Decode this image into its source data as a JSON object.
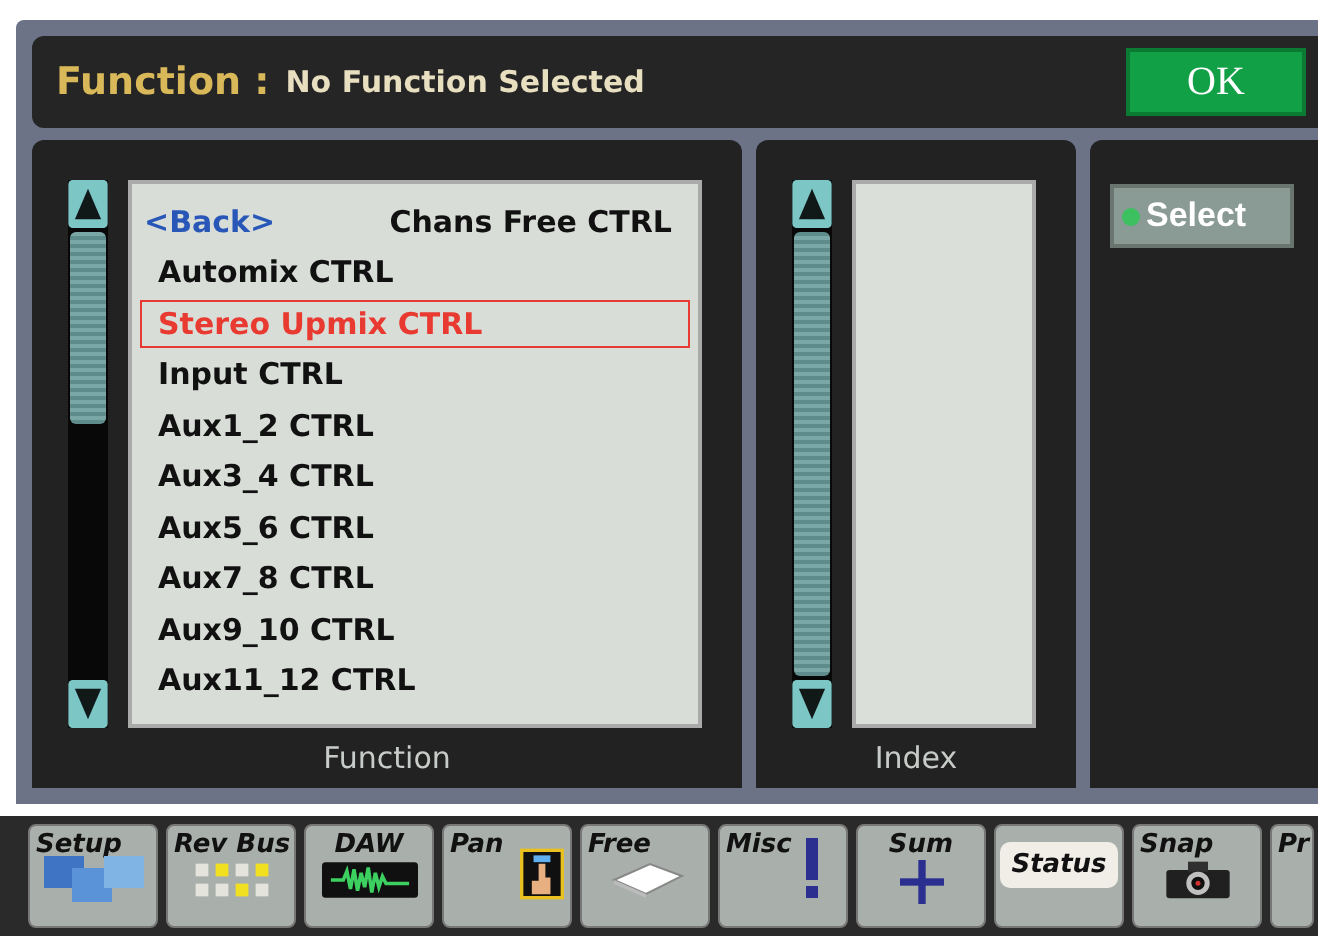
{
  "header": {
    "title": "Function :",
    "status": "No Function Selected",
    "ok_button": "OK"
  },
  "function_panel": {
    "back_link": "<Back>",
    "items": [
      {
        "label": "Chans Free CTRL",
        "selected": false
      },
      {
        "label": "Automix CTRL",
        "selected": false
      },
      {
        "label": "Stereo Upmix CTRL",
        "selected": true
      },
      {
        "label": "Input CTRL",
        "selected": false
      },
      {
        "label": "Aux1_2 CTRL",
        "selected": false
      },
      {
        "label": "Aux3_4 CTRL",
        "selected": false
      },
      {
        "label": "Aux5_6 CTRL",
        "selected": false
      },
      {
        "label": "Aux7_8 CTRL",
        "selected": false
      },
      {
        "label": "Aux9_10 CTRL",
        "selected": false
      },
      {
        "label": "Aux11_12 CTRL",
        "selected": false
      }
    ],
    "caption": "Function"
  },
  "index_panel": {
    "caption": "Index"
  },
  "select_button": "Select",
  "tabs": [
    {
      "label": "Setup",
      "kind": "setup",
      "selected": false
    },
    {
      "label": "Rev Bus",
      "kind": "revbus",
      "selected": false
    },
    {
      "label": "DAW",
      "kind": "daw",
      "selected": false
    },
    {
      "label": "Pan",
      "kind": "pan",
      "selected": false
    },
    {
      "label": "Free",
      "kind": "free",
      "selected": false
    },
    {
      "label": "Misc",
      "kind": "misc",
      "selected": false
    },
    {
      "label": "Sum",
      "kind": "sum",
      "selected": false
    },
    {
      "label": "Status",
      "kind": "status",
      "selected": true
    },
    {
      "label": "Snap",
      "kind": "snap",
      "selected": false
    },
    {
      "label": "Pr",
      "kind": "pr",
      "selected": false
    }
  ]
}
